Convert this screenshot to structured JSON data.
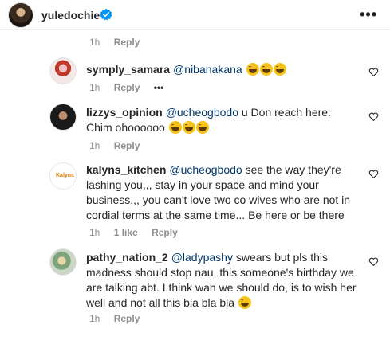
{
  "header": {
    "username": "yuledochie",
    "more_label": "•••"
  },
  "top_meta": {
    "time": "1h",
    "reply": "Reply"
  },
  "comments": [
    {
      "user": "symply_samara",
      "mention": "@nibanakana",
      "body": " ",
      "emoji_count": 3,
      "time": "1h",
      "likes": "",
      "reply": "Reply",
      "dots": "•••"
    },
    {
      "user": "lizzys_opinion",
      "mention": "@ucheogbodo",
      "body": " u Don reach here. Chim ohoooooo ",
      "time": "1h",
      "reply": "Reply"
    },
    {
      "user": "kalyns_kitchen",
      "mention": "@ucheogbodo",
      "body": " see the way they're lashing you,,, stay in your space and mind your business,,, you can't love two co wives who are not in cordial terms at the same time... Be here or be there",
      "time": "1h",
      "likes": "1 like",
      "reply": "Reply"
    },
    {
      "user": "pathy_nation_2",
      "mention": "@ladypashy",
      "body": " swears but pls this madness should stop nau, this someone's birthday we are talking abt. I think wah we should do, is to wish her well and not all this bla bla bla ",
      "time": "1h",
      "reply": "Reply"
    }
  ],
  "colors": {
    "mention": "#00376b",
    "verified": "#0095f6",
    "meta": "#8e8e8e"
  }
}
